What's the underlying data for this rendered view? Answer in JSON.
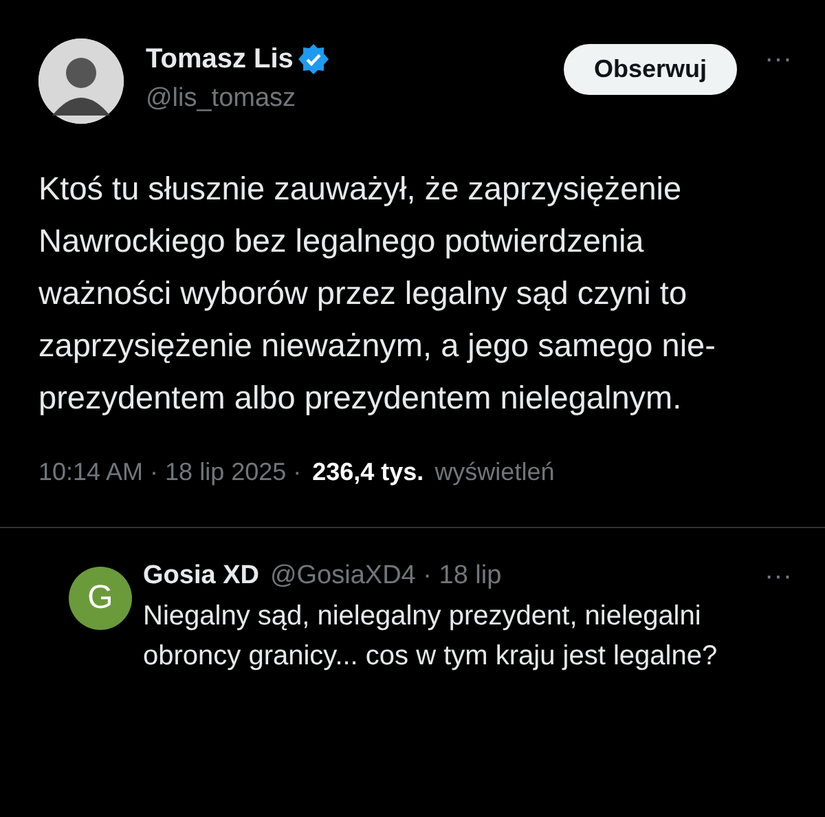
{
  "tweet": {
    "author": {
      "name": "Tomasz Lis",
      "handle": "@lis_tomasz",
      "verified": true
    },
    "follow_button": "Obserwuj",
    "more": "···",
    "text": "Ktoś tu słusznie zauważył, że zaprzysiężenie Nawrockiego bez legalnego potwierdzenia ważności wyborów przez legalny sąd czyni to zaprzysiężenie nieważnym, a jego samego nie- prezydentem albo prezydentem nielegalnym.",
    "timestamp": "10:14 AM · 18 lip 2025 ·",
    "views": "236,4 tys.",
    "views_label": "wyświetleń"
  },
  "reply": {
    "avatar_letter": "G",
    "name": "Gosia XD",
    "handle_date": "@GosiaXD4 · 18 lip",
    "more": "···",
    "text": "Niegalny sąd, nielegalny prezydent, nielegalni obroncy granicy... cos w tym kraju jest legalne?"
  }
}
